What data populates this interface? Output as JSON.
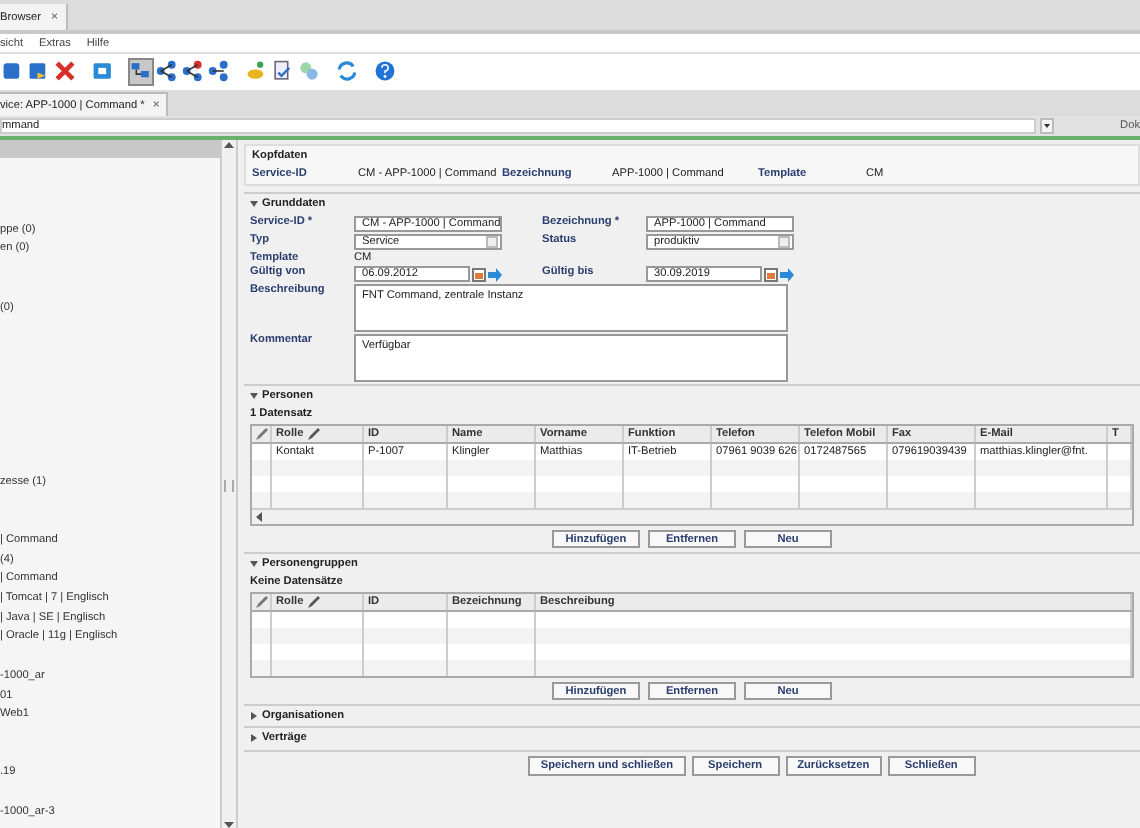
{
  "window_tab": {
    "title": "Browser",
    "close": "×"
  },
  "menu": [
    "sicht",
    "Extras",
    "Hilfe"
  ],
  "toolbar": [
    {
      "selected": false
    },
    {
      "selected": false
    },
    {
      "selected": false
    },
    {
      "selected": false
    },
    {
      "selected": true
    },
    {
      "selected": false
    },
    {
      "selected": false
    },
    {
      "selected": false
    },
    {
      "selected": false
    },
    {
      "selected": false
    },
    {
      "selected": false
    },
    {
      "selected": false
    },
    {
      "selected": false
    }
  ],
  "document_tab": {
    "title": "vice: APP-1000 | Command *",
    "close": "×"
  },
  "address": {
    "value": "mmand",
    "side_label": "Dok"
  },
  "tree": [
    "ppe (0)",
    "en (0)",
    "(0)",
    "zesse (1)",
    "| Command",
    "(4)",
    "| Command",
    "| Tomcat | 7 | Englisch",
    "| Java | SE | Englisch",
    "| Oracle | 11g | Englisch",
    "-1000_ar",
    "01",
    "Web1",
    ".19",
    "-1000_ar-3"
  ],
  "kopfdaten": {
    "title": "Kopfdaten",
    "fields": [
      {
        "label": "Service-ID",
        "value": "CM - APP-1000 | Command"
      },
      {
        "label": "Bezeichnung",
        "value": "APP-1000 | Command"
      },
      {
        "label": "Template",
        "value": "CM"
      }
    ]
  },
  "grunddaten": {
    "title": "Grunddaten",
    "expanded": true,
    "rows": [
      [
        {
          "label": "Service-ID *",
          "kind": "input",
          "value": "CM - APP-1000 | Command"
        },
        {
          "label": "Bezeichnung *",
          "kind": "input",
          "value": "APP-1000 | Command"
        }
      ],
      [
        {
          "label": "Typ",
          "kind": "select",
          "value": "Service"
        },
        {
          "label": "Status",
          "kind": "select",
          "value": "produktiv"
        }
      ],
      [
        {
          "label": "Template",
          "kind": "text",
          "value": "CM"
        }
      ],
      [
        {
          "label": "Gültig von",
          "kind": "date",
          "value": "06.09.2012"
        },
        {
          "label": "Gültig bis",
          "kind": "date",
          "value": "30.09.2019"
        }
      ],
      [
        {
          "label": "Beschreibung",
          "kind": "textarea",
          "value": "FNT Command, zentrale Instanz"
        }
      ],
      [
        {
          "label": "Kommentar",
          "kind": "textarea",
          "value": "Verfügbar"
        }
      ]
    ]
  },
  "personen": {
    "title": "Personen",
    "expanded": true,
    "count": "1 Datensatz",
    "columns": [
      "Rolle",
      "ID",
      "Name",
      "Vorname",
      "Funktion",
      "Telefon",
      "Telefon Mobil",
      "Fax",
      "E-Mail",
      "T"
    ],
    "rows": [
      [
        "Kontakt",
        "P-1007",
        "Klingler",
        "Matthias",
        "IT-Betrieb",
        "07961 9039 626",
        "0172487565",
        "079619039439",
        "matthias.klingler@fnt."
      ]
    ],
    "buttons": [
      "Hinzufügen",
      "Entfernen",
      "Neu"
    ]
  },
  "personengruppen": {
    "title": "Personengruppen",
    "expanded": true,
    "count": "Keine Datensätze",
    "columns": [
      "Rolle",
      "ID",
      "Bezeichnung",
      "Beschreibung"
    ],
    "buttons": [
      "Hinzufügen",
      "Entfernen",
      "Neu"
    ]
  },
  "collapsed_sections": [
    {
      "title": "Organisationen",
      "expanded": false
    },
    {
      "title": "Verträge",
      "expanded": false
    }
  ],
  "footer_buttons": [
    "Speichern und schließen",
    "Speichern",
    "Zurücksetzen",
    "Schließen"
  ]
}
